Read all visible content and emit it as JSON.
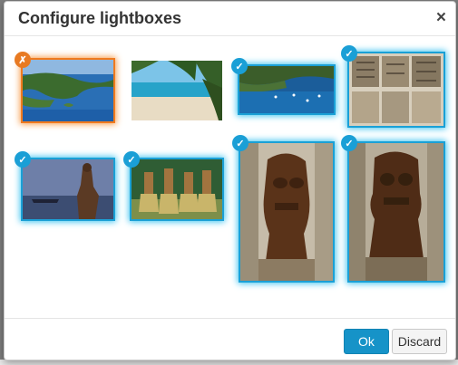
{
  "dialog": {
    "title": "Configure lightboxes",
    "close_glyph": "×"
  },
  "lightboxes": [
    {
      "id": "photo-1",
      "subject": "Aerial coastline with bay and islets",
      "selected": false,
      "badge_glyph": "✗"
    },
    {
      "id": "photo-2",
      "subject": "Sandy beach with palm fronds",
      "selected": true,
      "badge_glyph": ""
    },
    {
      "id": "photo-3",
      "subject": "Harbor with anchored boats",
      "selected": true,
      "badge_glyph": "✓"
    },
    {
      "id": "photo-4",
      "subject": "Carved tapa panels",
      "selected": true,
      "badge_glyph": "✓"
    },
    {
      "id": "photo-5",
      "subject": "Warrior on shore at dusk",
      "selected": true,
      "badge_glyph": "✓"
    },
    {
      "id": "photo-6",
      "subject": "Dancers in grass costumes",
      "selected": true,
      "badge_glyph": "✓"
    },
    {
      "id": "photo-7",
      "subject": "Wooden tiki carving",
      "selected": true,
      "badge_glyph": "✓"
    },
    {
      "id": "photo-8",
      "subject": "Wooden tiki figure",
      "selected": true,
      "badge_glyph": "✓"
    }
  ],
  "footer": {
    "ok_label": "Ok",
    "discard_label": "Discard"
  },
  "colors": {
    "selected_glow": "#3cc3f0",
    "deselected_glow": "#f79a47",
    "primary_button": "#1693c8"
  }
}
